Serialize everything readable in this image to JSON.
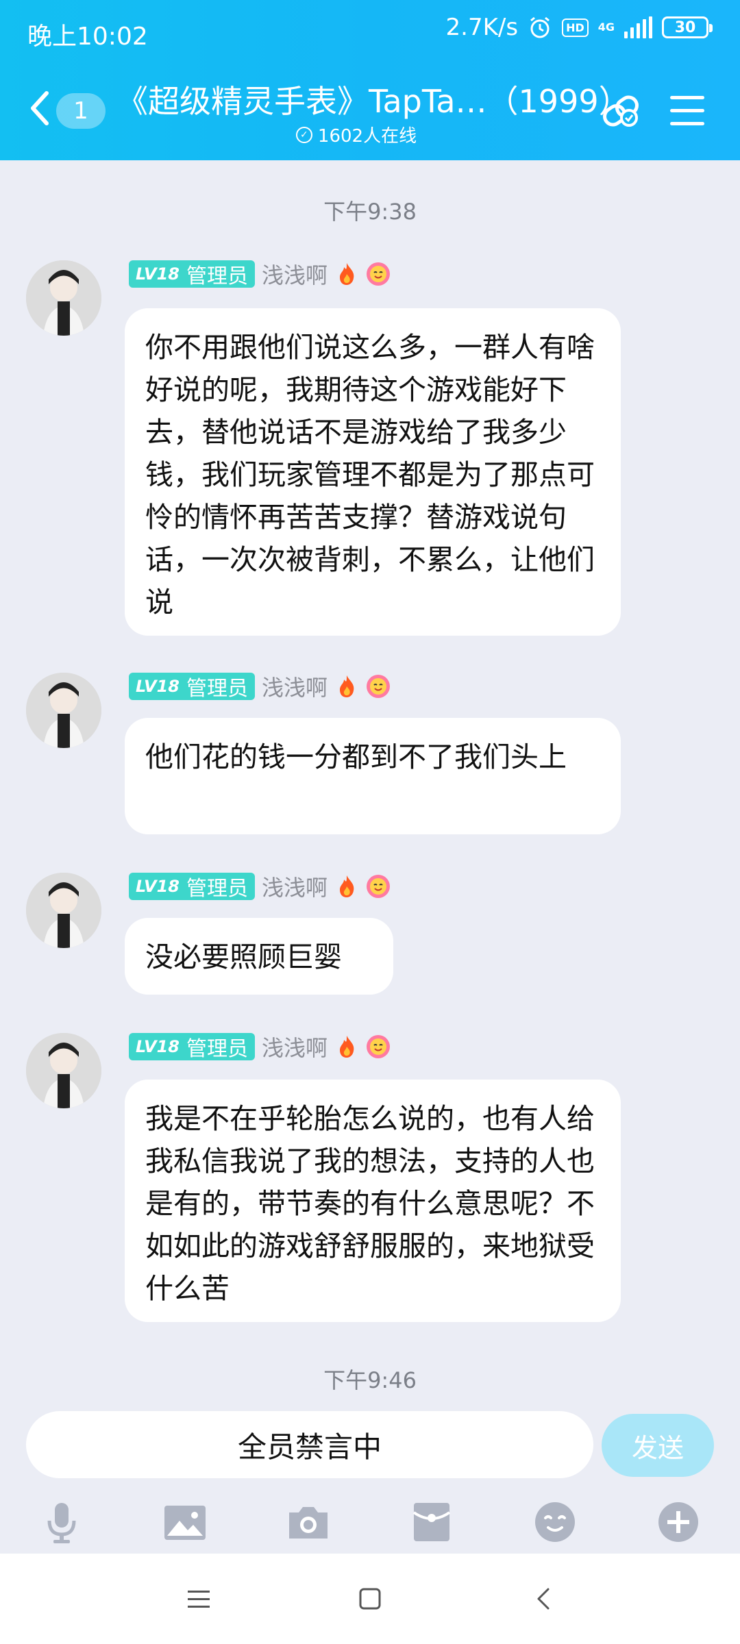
{
  "status_bar": {
    "time": "晚上10:02",
    "net_speed": "2.7K/s",
    "hd_label": "HD",
    "network_type": "4G",
    "battery": "30"
  },
  "header": {
    "unread_count": "1",
    "title": "《超级精灵手表》TapTa…（1999）",
    "online_text": "1602人在线"
  },
  "messages": [
    {
      "timestamp": "下午9:38",
      "level": "LV18",
      "role": "管理员",
      "nickname": "浅浅啊",
      "text": "你不用跟他们说这么多，一群人有啥好说的呢，我期待这个游戏能好下去，替他说话不是游戏给了我多少钱，我们玩家管理不都是为了那点可怜的情怀再苦苦支撑？替游戏说句话，一次次被背刺，不累么，让他们说"
    },
    {
      "level": "LV18",
      "role": "管理员",
      "nickname": "浅浅啊",
      "text": "他们花的钱一分都到不了我们头上"
    },
    {
      "level": "LV18",
      "role": "管理员",
      "nickname": "浅浅啊",
      "text": "没必要照顾巨婴"
    },
    {
      "level": "LV18",
      "role": "管理员",
      "nickname": "浅浅啊",
      "text": "我是不在乎轮胎怎么说的，也有人给我私信我说了我的想法，支持的人也是有的，带节奏的有什么意思呢？不如如此的游戏舒舒服服的，来地狱受什么苦"
    }
  ],
  "bottom_timestamp": "下午9:46",
  "input": {
    "muted_text": "全员禁言中",
    "send_label": "发送"
  },
  "toolbar_icons": [
    "microphone-icon",
    "image-icon",
    "camera-icon",
    "red-packet-icon",
    "emoji-icon",
    "plus-icon"
  ],
  "nav_icons": [
    "menu-icon",
    "home-icon",
    "back-icon"
  ],
  "colors": {
    "header_bg": "#15b7f6",
    "badge_bg": "#3dd6cb",
    "send_bg": "#a9e6f8",
    "chat_bg": "#ebedf5"
  }
}
